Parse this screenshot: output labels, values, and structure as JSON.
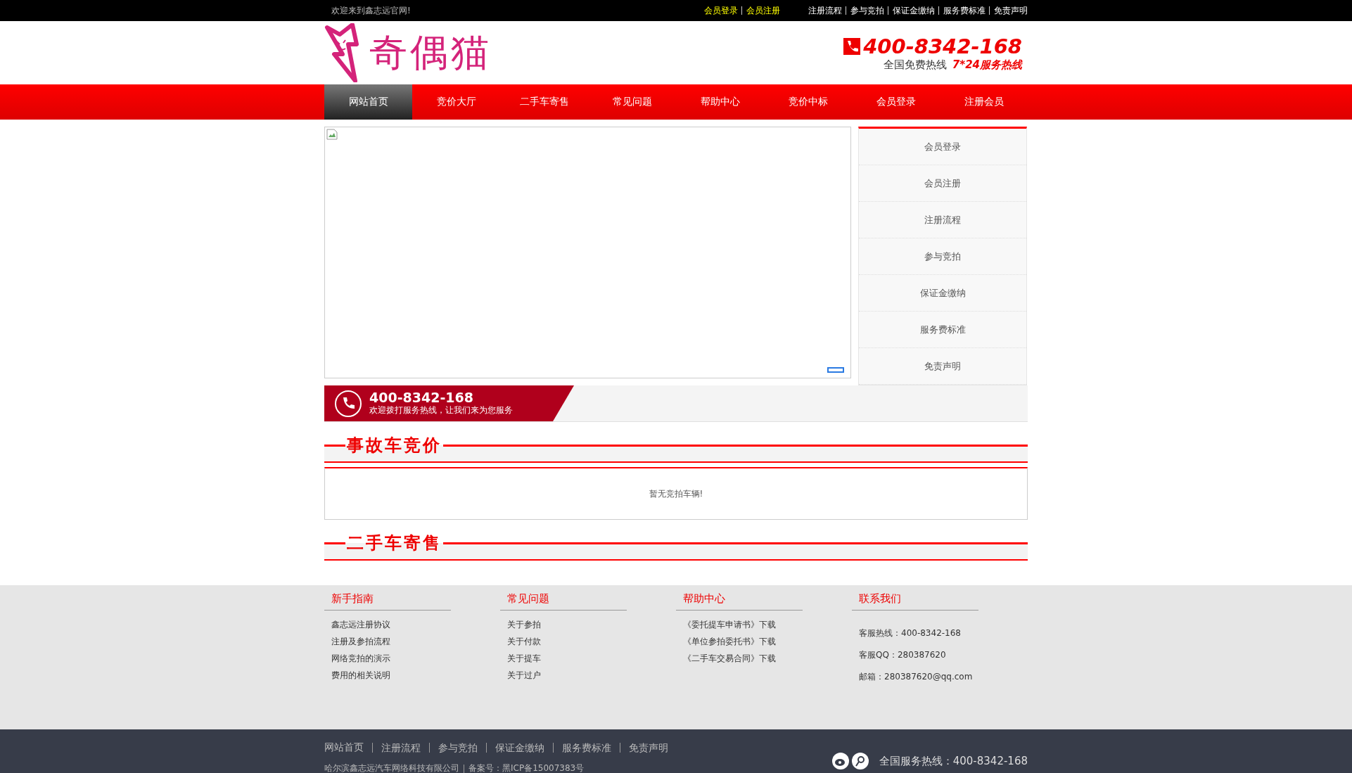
{
  "top_bar": {
    "welcome": "欢迎来到鑫志远官网!",
    "links": [
      {
        "label": "会员登录",
        "highlighted": true
      },
      {
        "label": "会员注册",
        "highlighted": true
      },
      {
        "label": "注册流程",
        "highlighted": false
      },
      {
        "label": "参与竞拍",
        "highlighted": false
      },
      {
        "label": "保证金缴纳",
        "highlighted": false
      },
      {
        "label": "服务费标准",
        "highlighted": false
      },
      {
        "label": "免责声明",
        "highlighted": false
      }
    ]
  },
  "header": {
    "logo_text": "奇偶猫",
    "hotline_number": "400-8342-168",
    "hotline_label": "全国免费热线",
    "hotline_hours": "7*24服务热线"
  },
  "nav": [
    {
      "label": "网站首页",
      "selected": true
    },
    {
      "label": "竞价大厅",
      "selected": false
    },
    {
      "label": "二手车寄售",
      "selected": false
    },
    {
      "label": "常见问题",
      "selected": false
    },
    {
      "label": "帮助中心",
      "selected": false
    },
    {
      "label": "竞价中标",
      "selected": false
    },
    {
      "label": "会员登录",
      "selected": false
    },
    {
      "label": "注册会员",
      "selected": false
    }
  ],
  "sidebar": [
    "会员登录",
    "会员注册",
    "注册流程",
    "参与竞拍",
    "保证金缴纳",
    "服务费标准",
    "免责声明"
  ],
  "phone_strip": {
    "number": "400-8342-168",
    "caption": "欢迎拨打服务热线，让我们来为您服务"
  },
  "sections": [
    {
      "title": "事故车竞价",
      "empty_text": "暂无竞拍车辆!"
    },
    {
      "title": "二手车寄售"
    }
  ],
  "footer_columns": [
    {
      "kind": "links",
      "title": "新手指南",
      "items": [
        "鑫志远注册协议",
        "注册及参拍流程",
        "网络竞拍的演示",
        "费用的相关说明"
      ]
    },
    {
      "kind": "links",
      "title": "常见问题",
      "items": [
        "关于参拍",
        "关于付款",
        "关于提车",
        "关于过户"
      ]
    },
    {
      "kind": "links",
      "title": "帮助中心",
      "items": [
        "《委托提车申请书》下载",
        "《单位参拍委托书》下载",
        "《二手车交易合同》下载"
      ]
    },
    {
      "kind": "contact",
      "title": "联系我们",
      "items": [
        "客服热线：400-8342-168",
        "客服QQ：280387620",
        "邮箱：280387620@qq.com"
      ]
    }
  ],
  "bottom": {
    "links": [
      "网站首页",
      "注册流程",
      "参与竞拍",
      "保证金缴纳",
      "服务费标准",
      "免责声明"
    ],
    "company": "哈尔滨鑫志远汽车网络科技有限公司",
    "icp": "备案号：黑ICP备15007383号",
    "hotline": "全国服务热线：400-8342-168"
  }
}
